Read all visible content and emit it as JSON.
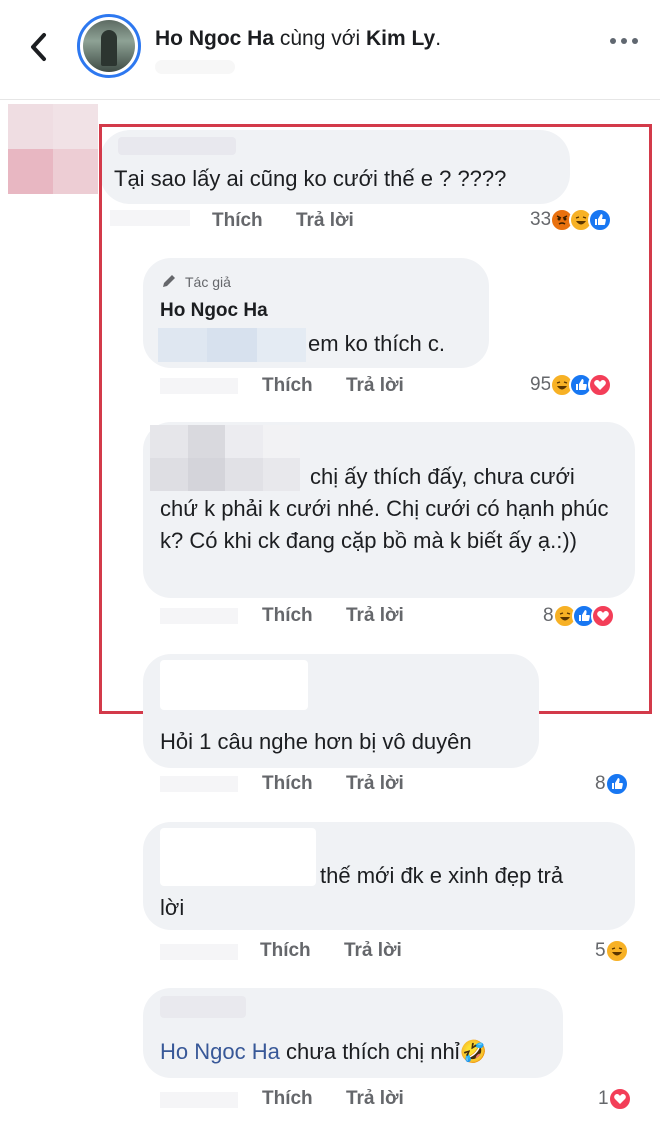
{
  "header": {
    "author": "Ho Ngoc Ha",
    "with_text": " cùng với ",
    "tagged": "Kim Ly",
    "tagged_suffix": "."
  },
  "labels": {
    "like": "Thích",
    "reply": "Trả lời",
    "author_badge": "Tác giả"
  },
  "comments": [
    {
      "text": "Tại sao lấy ai cũng ko cưới thế e ? ????",
      "reaction_count": "33",
      "reactions": [
        "angry-icon",
        "haha-icon",
        "like-icon"
      ]
    },
    {
      "author": "Ho Ngoc Ha",
      "text": "em ko thích c.",
      "reaction_count": "95",
      "reactions": [
        "haha-icon",
        "like-icon",
        "love-icon"
      ]
    },
    {
      "text_line1": "chị ấy thích đấy, chưa cưới",
      "text_rest": "chứ k phải k cưới nhé. Chị cưới có hạnh phúc k? Có khi ck đang cặp bồ mà k biết ấy ạ.:))",
      "reaction_count": "8",
      "reactions": [
        "haha-icon",
        "like-icon",
        "love-icon"
      ]
    },
    {
      "text": "Hỏi 1 câu nghe hơn bị vô duyên",
      "reaction_count": "8",
      "reactions": [
        "like-icon"
      ]
    },
    {
      "text_line1": "thế mới đk e xinh đẹp  trả",
      "text_rest": "lời",
      "reaction_count": "5",
      "reactions": [
        "haha-icon"
      ]
    },
    {
      "mention": "Ho Ngoc Ha",
      "text": " chưa thích chị nhỉ",
      "emoji": "🤣",
      "reaction_count": "1",
      "reactions": [
        "love-icon"
      ]
    }
  ],
  "colors": {
    "highlight_border": "#d33a4a",
    "bubble_bg": "#f0f2f5",
    "mention": "#385898",
    "like": "#1877f2",
    "love": "#f33e58",
    "haha": "#f7b125",
    "angry": "#e9710f"
  }
}
